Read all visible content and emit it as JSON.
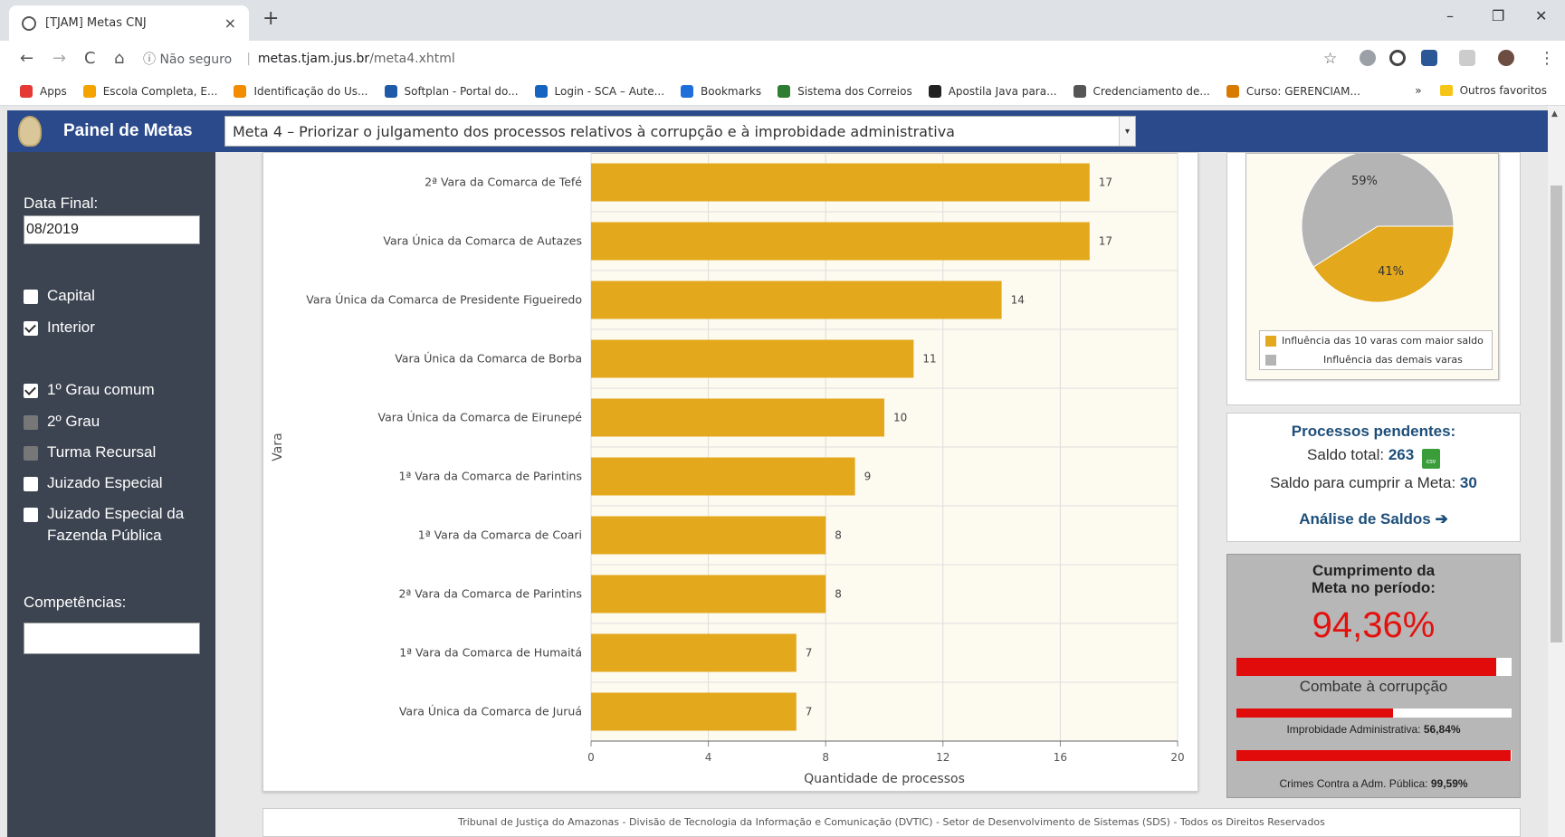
{
  "browser": {
    "tab_title": "[TJAM] Metas CNJ",
    "tab_close": "×",
    "new_tab": "+",
    "window_controls": [
      "–",
      "❐",
      "✕"
    ],
    "nav": {
      "back": "←",
      "forward": "→",
      "reload": "C",
      "home": "⌂"
    },
    "address": {
      "security": "ⓘ Não seguro",
      "sep": "|",
      "host": "metas.tjam.jus.br",
      "path": "/meta4.xhtml"
    },
    "star": "☆",
    "menu": "⋮",
    "bookmarks": [
      {
        "label": "Apps",
        "color": "#e53935"
      },
      {
        "label": "Escola Completa, E...",
        "color": "#f4a300"
      },
      {
        "label": "Identificação do Us...",
        "color": "#f28c00"
      },
      {
        "label": "Softplan - Portal do...",
        "color": "#1e5aa8"
      },
      {
        "label": "Login - SCA – Aute...",
        "color": "#1565c0"
      },
      {
        "label": "Bookmarks",
        "color": "#1e6fd9"
      },
      {
        "label": "Sistema dos Correios",
        "color": "#2e7d32"
      },
      {
        "label": "Apostila Java para...",
        "color": "#222222"
      },
      {
        "label": "Credenciamento de...",
        "color": "#555555"
      },
      {
        "label": "Curso: GERENCIAM...",
        "color": "#d97a00"
      }
    ],
    "bookmarks_more": "»",
    "other_bookmarks": "Outros favoritos"
  },
  "header": {
    "brand": "Painel de Metas",
    "meta_selected": "Meta 4 – Priorizar o julgamento dos processos relativos à corrupção e à improbidade administrativa",
    "caret": "▾"
  },
  "sidebar": {
    "data_final_label": "Data Final:",
    "data_final_value": "08/2019",
    "filters_location": [
      {
        "label": "Capital",
        "checked": false
      },
      {
        "label": "Interior",
        "checked": true
      }
    ],
    "filters_grau": [
      {
        "label": "1º Grau comum",
        "checked": true,
        "dim": false
      },
      {
        "label": "2º Grau",
        "checked": false,
        "dim": true
      },
      {
        "label": "Turma Recursal",
        "checked": false,
        "dim": true
      },
      {
        "label": "Juizado Especial",
        "checked": false,
        "dim": false
      },
      {
        "label": "Juizado Especial da Fazenda Pública",
        "checked": false,
        "dim": false
      }
    ],
    "competencias_label": "Competências:",
    "competencias_value": ""
  },
  "chart_data": {
    "type": "bar",
    "orientation": "horizontal",
    "categories": [
      "2ª Vara da Comarca de Tefé",
      "Vara Única da Comarca de Autazes",
      "Vara Única da Comarca de Presidente Figueiredo",
      "Vara Única da Comarca de Borba",
      "Vara Única da Comarca de Eirunepé",
      "1ª Vara da Comarca de Parintins",
      "1ª Vara da Comarca de Coari",
      "2ª Vara da Comarca de Parintins",
      "1ª Vara da Comarca de Humaitá",
      "Vara Única da Comarca de Juruá"
    ],
    "values": [
      17,
      17,
      14,
      11,
      10,
      9,
      8,
      8,
      7,
      7
    ],
    "xlabel": "Quantidade de processos",
    "ylabel": "Vara",
    "xlim": [
      0,
      20
    ],
    "xticks": [
      0,
      4,
      8,
      12,
      16,
      20
    ],
    "bar_color": "#e3a81c",
    "plot_bg": "#fdfaf0",
    "grid": true
  },
  "pie_chart": {
    "type": "pie",
    "slices": [
      {
        "label": "Influência das 10 varas com maior saldo",
        "value": 41,
        "text": "41%",
        "color": "#e3a81c"
      },
      {
        "label": "Influência das demais varas",
        "value": 59,
        "text": "59%",
        "color": "#b4b4b4"
      }
    ]
  },
  "pendentes": {
    "title": "Processos pendentes:",
    "saldo_total_label": "Saldo total:",
    "saldo_total": "263",
    "csv": "csv",
    "saldo_meta_label": "Saldo para cumprir a Meta:",
    "saldo_meta": "30",
    "link": "Análise de Saldos ➔"
  },
  "cumprimento": {
    "title_line1": "Cumprimento da",
    "title_line2": "Meta no período:",
    "value": "94,36%",
    "value_fraction": 0.9436,
    "subtitle": "Combate à corrupção",
    "improbidade_label": "Improbidade Administrativa:",
    "improbidade_value": "56,84%",
    "improbidade_fraction": 0.5684,
    "crimes_label": "Crimes Contra a Adm. Pública:",
    "crimes_value": "99,59%",
    "crimes_fraction": 0.9959,
    "bar_color": "#e10b0b"
  },
  "footer": "Tribunal de Justiça do Amazonas - Divisão de Tecnologia da Informação e Comunicação (DVTIC) - Setor de Desenvolvimento de Sistemas (SDS) - Todos os Direitos Reservados"
}
